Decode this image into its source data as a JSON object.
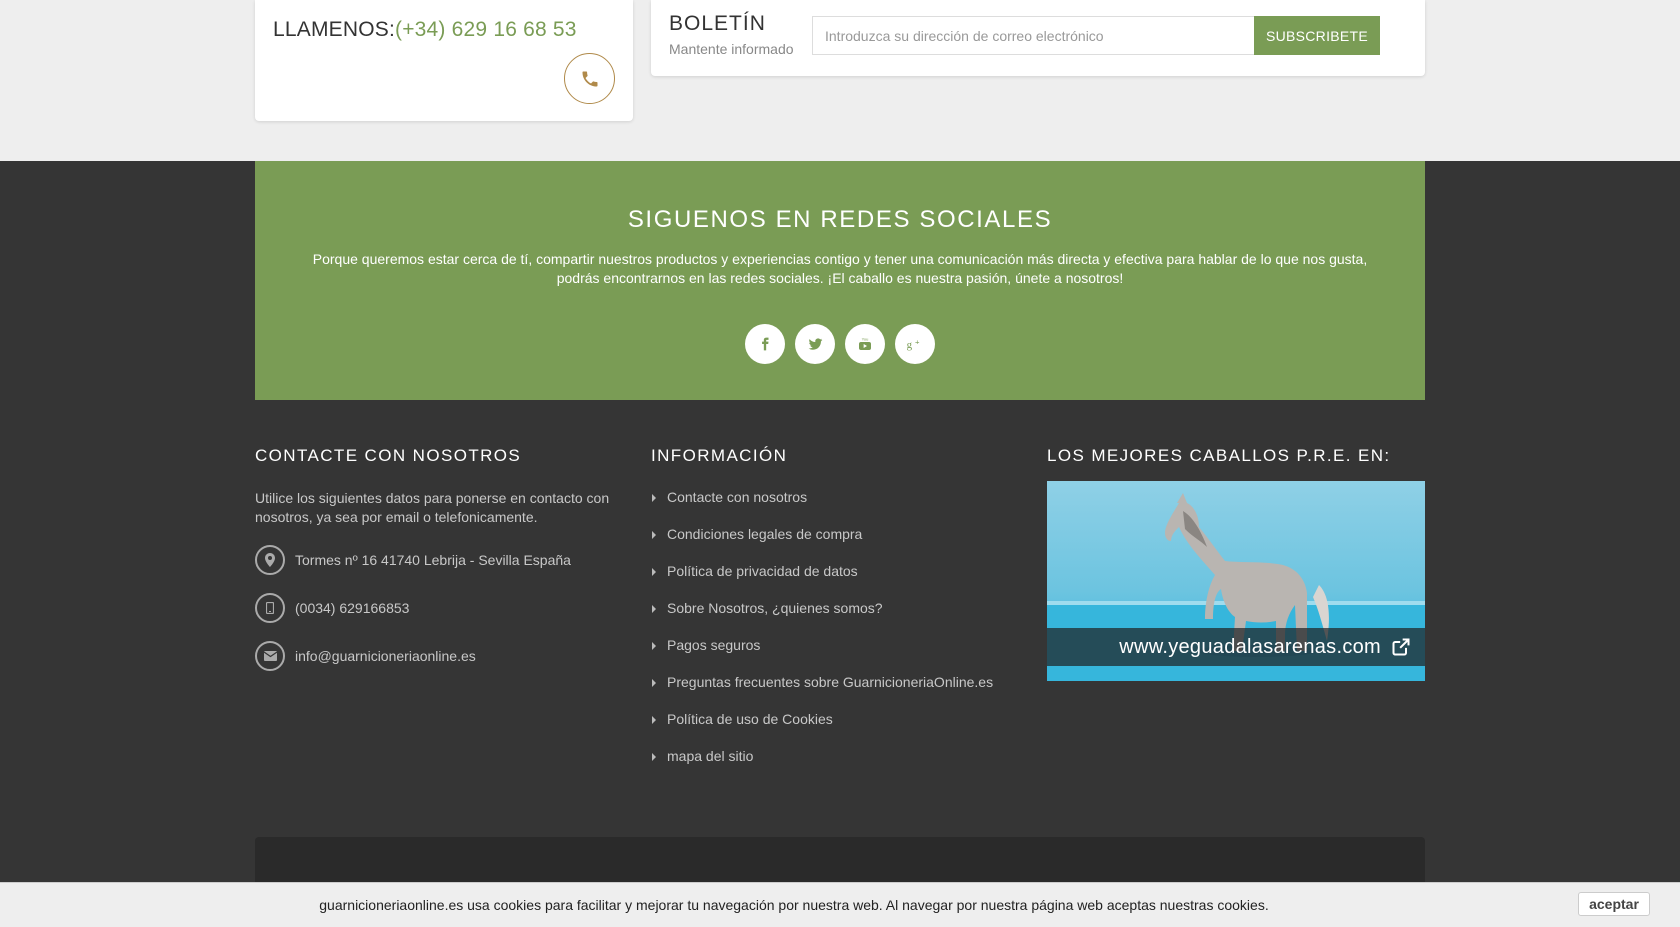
{
  "call": {
    "label": "LLAMENOS:",
    "number": "(+34) 629 16 68 53",
    "icon": "phone-icon"
  },
  "newsletter": {
    "title": "BOLETÍN",
    "subtitle": "Mantente informado",
    "placeholder": "Introduzca su dirección de correo electrónico",
    "button": "SUBSCRIBETE"
  },
  "social": {
    "title": "SIGUENOS EN REDES SOCIALES",
    "text": "Porque queremos estar cerca de tí, compartir nuestros productos y experiencias contigo y tener una comunicación más directa y efectiva para hablar de lo que nos gusta, podrás encontrarnos en las redes sociales. ¡El caballo es nuestra pasión, únete a nosotros!",
    "icons": [
      "facebook-icon",
      "twitter-icon",
      "youtube-icon",
      "google-plus-icon"
    ]
  },
  "contact": {
    "title": "CONTACTE CON NOSOTROS",
    "text": "Utilice los siguientes datos para ponerse en contacto con nosotros, ya sea por email o telefonicamente.",
    "address": "Tormes nº 16 41740 Lebrija - Sevilla España",
    "phone": "(0034) 629166853",
    "email": "info@guarnicioneriaonline.es"
  },
  "info": {
    "title": "INFORMACIÓN",
    "links": [
      "Contacte con nosotros",
      "Condiciones legales de compra",
      "Política de privacidad de datos",
      "Sobre Nosotros, ¿quienes somos?",
      "Pagos seguros",
      "Preguntas frecuentes sobre GuarnicioneriaOnline.es",
      "Política de uso de Cookies",
      "mapa del sitio"
    ]
  },
  "promo": {
    "title": "LOS MEJORES CABALLOS P.R.E. EN:",
    "link": "www.yeguadalasarenas.com"
  },
  "cookie": {
    "text": "guarnicioneriaonline.es usa cookies para facilitar y mejorar tu navegación por nuestra web. Al navegar por nuestra página web aceptas nuestras cookies.",
    "button": "aceptar"
  },
  "colors": {
    "accent_green": "#7a9c55",
    "phone_gold": "#b08a4a",
    "footer_bg": "#353535"
  }
}
